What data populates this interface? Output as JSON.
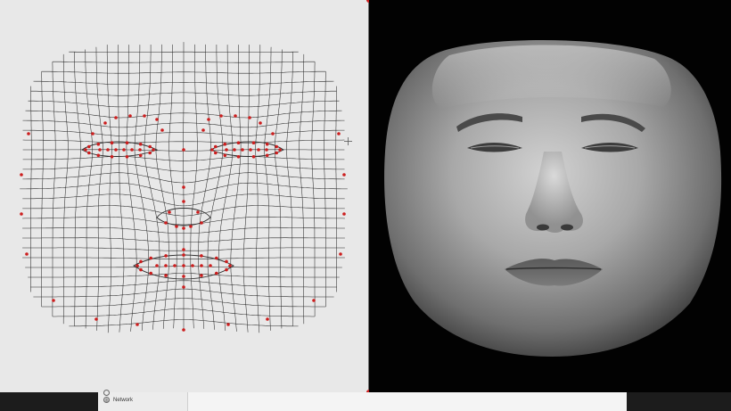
{
  "colors": {
    "mesh_background": "#e8e8e8",
    "mesh_line": "#2b2b2b",
    "landmark": "#cc1e1e",
    "viewport_background": "#020202",
    "face_skin": "#9a9a9a"
  },
  "taskbar": {
    "items": [
      {
        "label": "",
        "icon": "drive-icon"
      },
      {
        "label": "Network",
        "icon": "globe-icon"
      }
    ]
  }
}
